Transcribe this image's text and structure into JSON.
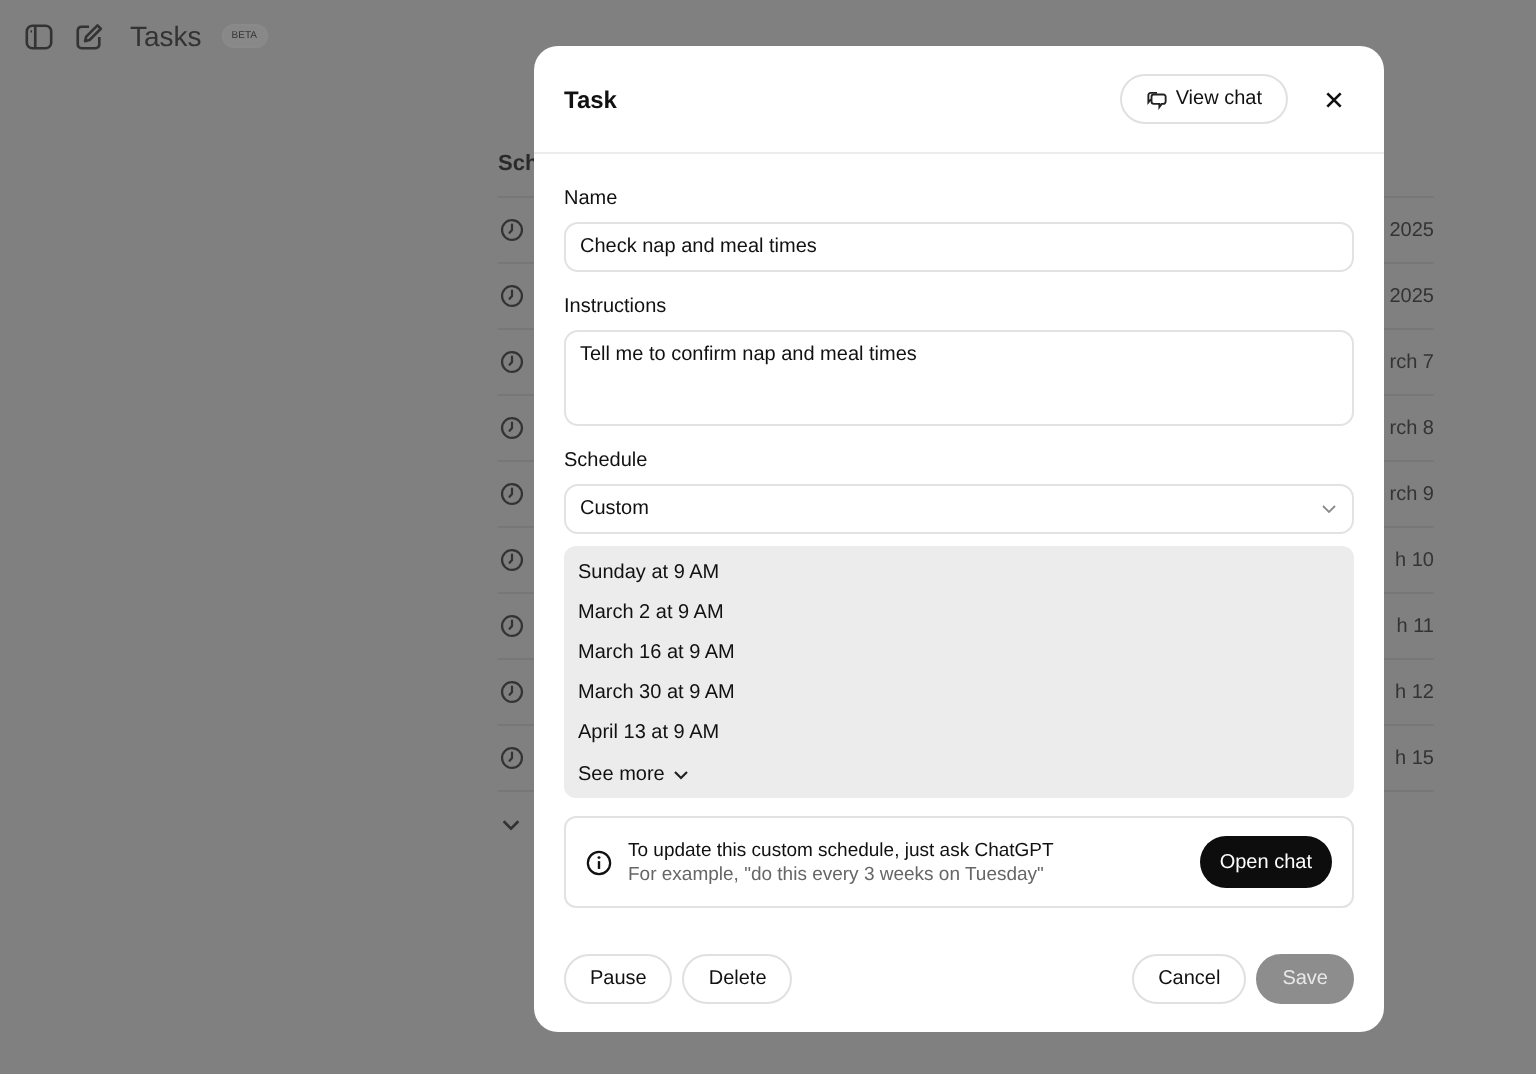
{
  "header": {
    "title": "Tasks",
    "badge": "BETA"
  },
  "background_list": {
    "heading": "Sch",
    "rows": [
      {
        "date": "2025"
      },
      {
        "date": "2025"
      },
      {
        "date": "rch 7"
      },
      {
        "date": "rch 8"
      },
      {
        "date": "rch 9"
      },
      {
        "date": "h 10"
      },
      {
        "date": "h 11"
      },
      {
        "date": "h 12"
      },
      {
        "date": "h 15"
      }
    ]
  },
  "dialog": {
    "title": "Task",
    "view_chat": "View chat",
    "name": {
      "label": "Name",
      "value": "Check nap and meal times"
    },
    "instructions": {
      "label": "Instructions",
      "value": "Tell me to confirm nap and meal times"
    },
    "schedule": {
      "label": "Schedule",
      "value": "Custom"
    },
    "occurrences": [
      "Sunday at 9 AM",
      "March 2 at 9 AM",
      "March 16 at 9 AM",
      "March 30 at 9 AM",
      "April 13 at 9 AM"
    ],
    "see_more": "See more",
    "info": {
      "title": "To update this custom schedule, just ask ChatGPT",
      "example": "For example, \"do this every 3 weeks on Tuesday\"",
      "button": "Open chat"
    },
    "buttons_left": [
      {
        "label": "Pause",
        "disabled": false
      },
      {
        "label": "Delete",
        "disabled": false
      }
    ],
    "buttons_right": [
      {
        "label": "Cancel",
        "disabled": false
      },
      {
        "label": "Save",
        "disabled": true
      }
    ]
  }
}
